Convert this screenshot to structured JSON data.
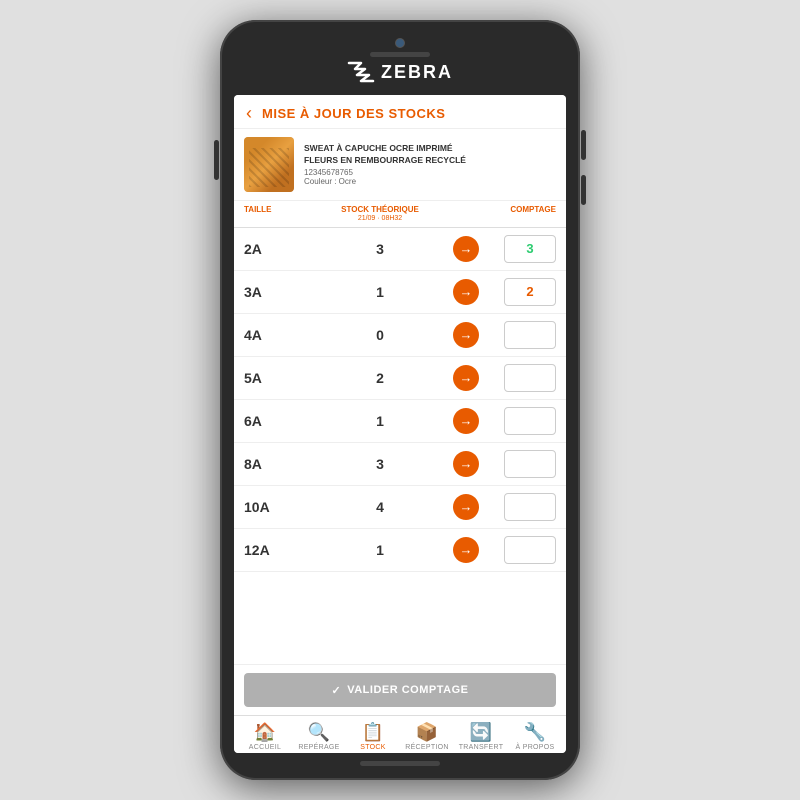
{
  "device": {
    "brand": "ZEBRA"
  },
  "header": {
    "back_label": "‹",
    "title": "MISE À JOUR DES STOCKS"
  },
  "product": {
    "name": "SWEAT À CAPUCHE OCRE IMPRIMÉ\nFLEURS EN REMBOURRAGE RECYCLÉ",
    "ref": "12345678765",
    "color_label": "Couleur : Ocre"
  },
  "table": {
    "col_taille": "TAILLE",
    "col_stock": "STOCK THÉORIQUE",
    "col_stock_date": "21/09 · 08H32",
    "col_comptage": "COMPTAGE",
    "rows": [
      {
        "size": "2A",
        "stock": 3,
        "count": "3",
        "count_class": "has-value-green"
      },
      {
        "size": "3A",
        "stock": 1,
        "count": "2",
        "count_class": "has-value-orange"
      },
      {
        "size": "4A",
        "stock": 0,
        "count": "",
        "count_class": ""
      },
      {
        "size": "5A",
        "stock": 2,
        "count": "",
        "count_class": ""
      },
      {
        "size": "6A",
        "stock": 1,
        "count": "",
        "count_class": ""
      },
      {
        "size": "8A",
        "stock": 3,
        "count": "",
        "count_class": ""
      },
      {
        "size": "10A",
        "stock": 4,
        "count": "",
        "count_class": ""
      },
      {
        "size": "12A",
        "stock": 1,
        "count": "",
        "count_class": ""
      }
    ]
  },
  "validate_btn": "VALIDER COMPTAGE",
  "nav": {
    "items": [
      {
        "id": "accueil",
        "label": "ACCUEIL",
        "icon": "🏠",
        "active": false
      },
      {
        "id": "reperage",
        "label": "REPÉRAGE",
        "icon": "🔍",
        "active": false
      },
      {
        "id": "stock",
        "label": "STOCK",
        "icon": "📋",
        "active": true
      },
      {
        "id": "reception",
        "label": "RÉCEPTION",
        "icon": "📦",
        "active": false
      },
      {
        "id": "transfert",
        "label": "TRANSFERT",
        "icon": "🔄",
        "active": false
      },
      {
        "id": "apropos",
        "label": "À PROPOS",
        "icon": "🔧",
        "active": false
      }
    ]
  }
}
